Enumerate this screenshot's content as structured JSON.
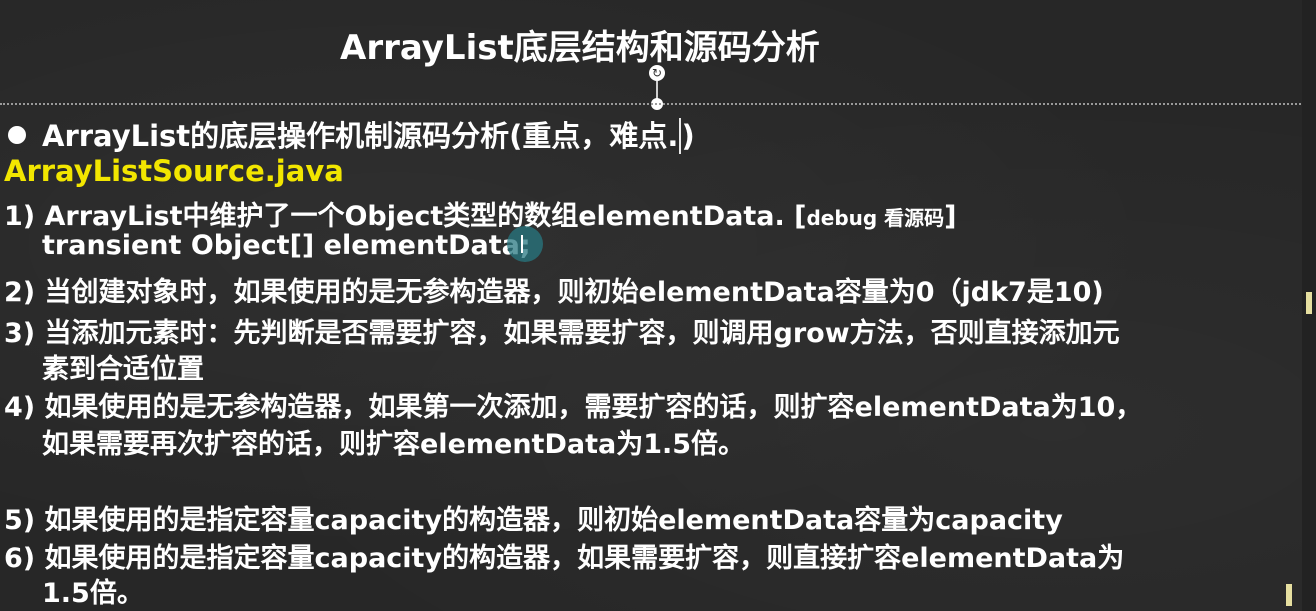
{
  "slide": {
    "title": "ArrayList底层结构和源码分析",
    "bullet": "ArrayList的底层操作机制源码分析(重点，难点.",
    "bullet_close": ")",
    "file_name": "ArrayListSource.java",
    "lines": [
      {
        "text": "1) ArrayList中维护了一个Object类型的数组elementData. [",
        "note": "debug 看源码",
        "tail": "]"
      },
      {
        "text": "transient Object[] elementData;"
      },
      {
        "text": "2) 当创建对象时，如果使用的是无参构造器，则初始elementData容量为0（jdk7是10)"
      },
      {
        "text": "3) 当添加元素时：先判断是否需要扩容，如果需要扩容，则调用grow方法，否则直接添加元"
      },
      {
        "text": "素到合适位置"
      },
      {
        "text": "4) 如果使用的是无参构造器，如果第一次添加，需要扩容的话，则扩容elementData为10，"
      },
      {
        "text": "如果需要再次扩容的话，则扩容elementData为1.5倍。"
      },
      {
        "text": "5) 如果使用的是指定容量capacity的构造器，则初始elementData容量为capacity"
      },
      {
        "text": "6) 如果使用的是指定容量capacity的构造器，如果需要扩容，则直接扩容elementData为"
      },
      {
        "text": "1.5倍。"
      }
    ]
  },
  "colors": {
    "background": "#272727",
    "text": "#ffffff",
    "filename": "#f2e600",
    "cursor": "#287882"
  },
  "icons": {
    "rotate_handle": "rotate-icon",
    "bullet": "bullet-dot-icon",
    "mouse": "mouse-cursor-icon"
  }
}
